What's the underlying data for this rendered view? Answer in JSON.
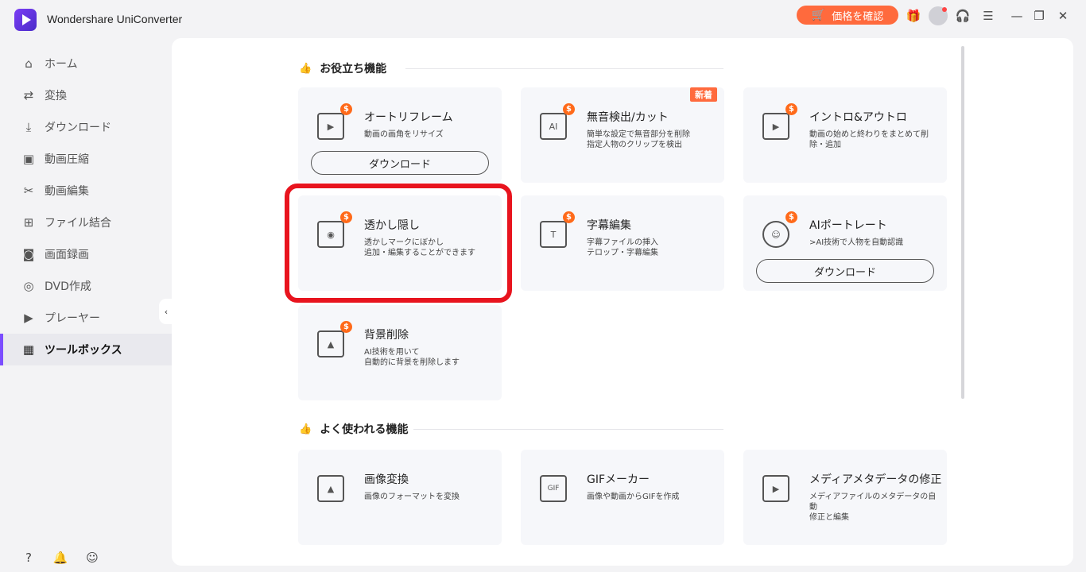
{
  "app": {
    "title": "Wondershare UniConverter"
  },
  "titlebar": {
    "price_label": "価格を確認"
  },
  "sidebar": {
    "items": [
      {
        "label": "ホーム",
        "icon": "home-icon"
      },
      {
        "label": "変換",
        "icon": "convert-icon"
      },
      {
        "label": "ダウンロード",
        "icon": "download-icon"
      },
      {
        "label": "動画圧縮",
        "icon": "compress-icon"
      },
      {
        "label": "動画編集",
        "icon": "scissors-icon"
      },
      {
        "label": "ファイル結合",
        "icon": "merge-icon"
      },
      {
        "label": "画面録画",
        "icon": "screen-record-icon"
      },
      {
        "label": "DVD作成",
        "icon": "dvd-icon"
      },
      {
        "label": "プレーヤー",
        "icon": "player-icon"
      },
      {
        "label": "ツールボックス",
        "icon": "toolbox-icon",
        "active": true
      }
    ]
  },
  "sections": {
    "useful": {
      "title": "お役立ち機能"
    },
    "frequent": {
      "title": "よく使われる機能"
    }
  },
  "cards": {
    "auto_reframe": {
      "title": "オートリフレーム",
      "desc": "動画の画角をリサイズ",
      "button": "ダウンロード"
    },
    "silence": {
      "title": "無音検出/カット",
      "desc": "簡単な設定で無音部分を削除\n指定人物のクリップを検出",
      "badge": "新着"
    },
    "intro_outro": {
      "title": "イントロ&アウトロ",
      "desc": "動画の始めと終わりをまとめて削\n除・追加"
    },
    "watermark": {
      "title": "透かし隠し",
      "desc": "透かしマークにぼかし\n追加・編集することができます"
    },
    "subtitle": {
      "title": "字幕編集",
      "desc": "字幕ファイルの挿入\nテロップ・字幕編集"
    },
    "ai_portrait": {
      "title": "AIポートレート",
      "desc": ">AI技術で人物を自動認識",
      "button": "ダウンロード"
    },
    "bg_remove": {
      "title": "背景削除",
      "desc": "AI技術を用いて\n自動的に背景を削除します"
    },
    "image_convert": {
      "title": "画像変換",
      "desc": "画像のフォーマットを変換"
    },
    "gif_maker": {
      "title": "GIFメーカー",
      "desc": "画像や動画からGIFを作成"
    },
    "metadata": {
      "title": "メディアメタデータの修正",
      "desc": "メディアファイルのメタデータの自動\n修正と編集"
    }
  },
  "colors": {
    "accent": "#7b4dff",
    "orange": "#ff6a3d",
    "highlight": "#e8141e"
  }
}
